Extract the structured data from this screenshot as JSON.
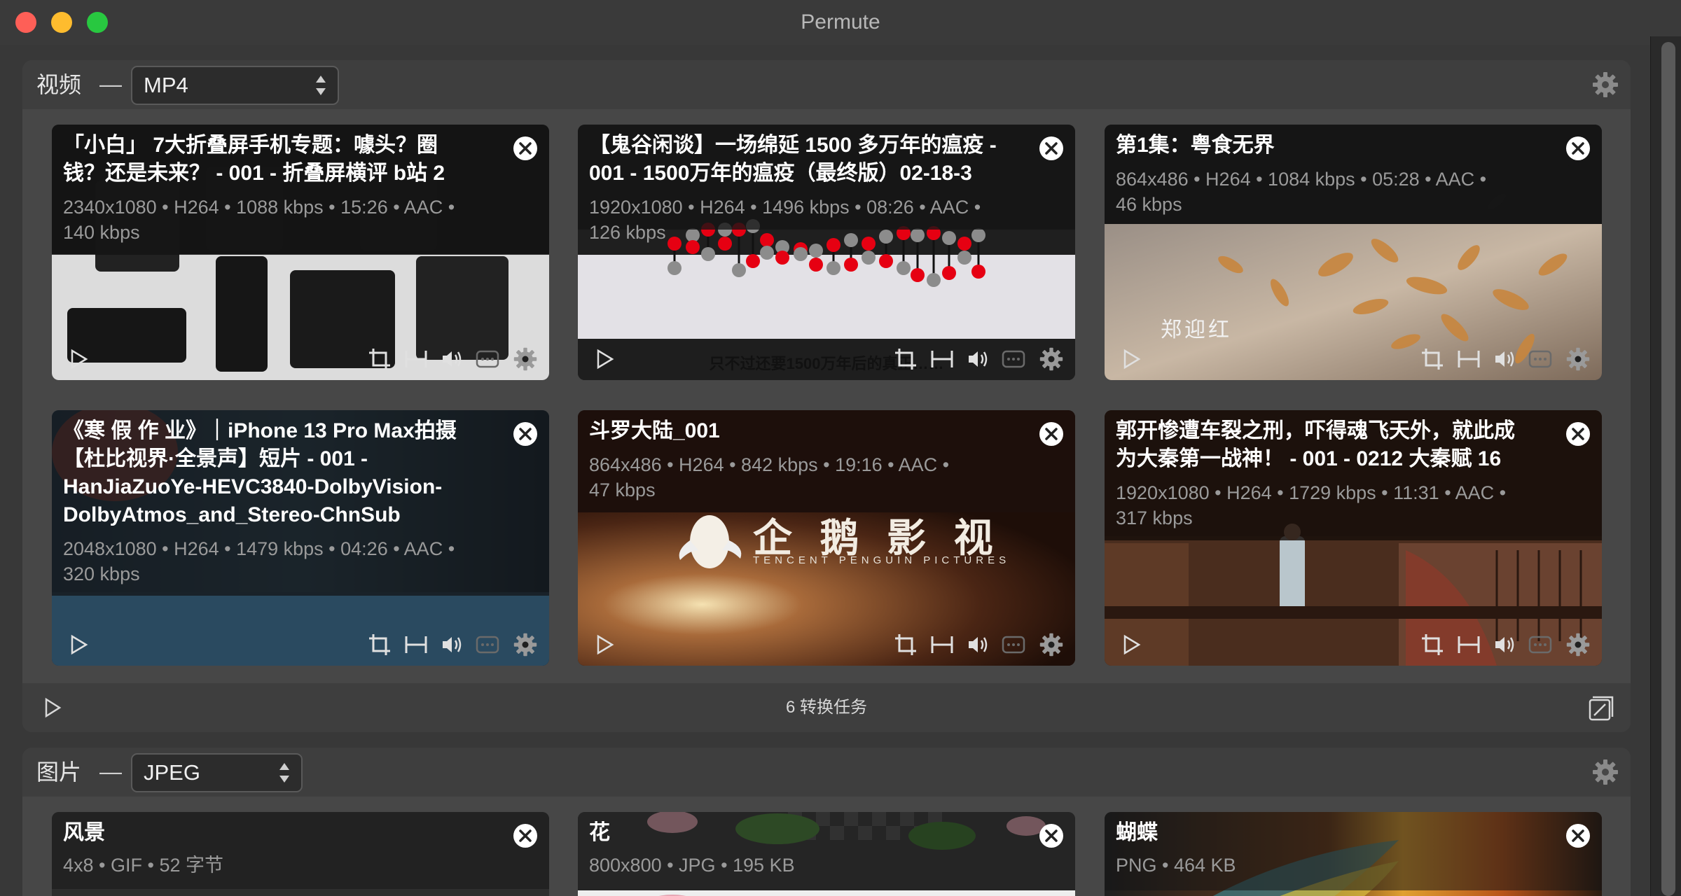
{
  "window": {
    "title": "Permute"
  },
  "sections": [
    {
      "label": "视频",
      "dash": "—",
      "format": "MP4",
      "status": "6 转换任务",
      "cards": [
        {
          "title": "「小白」 7大折叠屏手机专题：噱头？圈\n钱？还是未来？ - 001 - 折叠屏横评 b站 2",
          "meta": "2340x1080 • H264 • 1088 kbps • 15:26 • AAC •\n140 kbps"
        },
        {
          "title": "【鬼谷闲谈】一场绵延 1500 多万年的瘟疫 -\n001 - 1500万年的瘟疫（最终版）02-18-3",
          "meta": "1920x1080 • H264 • 1496 kbps • 08:26 • AAC •\n126 kbps",
          "caption": "只不过还要1500万年后的真正……"
        },
        {
          "title": "第1集：粤食无界",
          "meta": "864x486 • H264 • 1084 kbps • 05:28 • AAC •\n46 kbps",
          "caption": "郑迎红"
        },
        {
          "title": "《寒 假 作 业》｜iPhone 13 Pro Max拍摄\n【杜比视界·全景声】短片 - 001 -\nHanJiaZuoYe-HEVC3840-DolbyVision-\nDolbyAtmos_and_Stereo-ChnSub",
          "meta": "2048x1080 • H264 • 1479 kbps • 04:26 • AAC •\n320 kbps"
        },
        {
          "title": "斗罗大陆_001",
          "meta": "864x486 • H264 • 842 kbps • 19:16 • AAC •\n47 kbps",
          "logo_text": "企 鹅 影 视",
          "logo_sub": "TENCENT PENGUIN PICTURES"
        },
        {
          "title": "郭开惨遭车裂之刑，吓得魂飞天外，就此成\n为大秦第一战神！ - 001 - 0212 大秦赋 16",
          "meta": "1920x1080 • H264 • 1729 kbps • 11:31 • AAC •\n317 kbps"
        }
      ]
    },
    {
      "label": "图片",
      "dash": "—",
      "format": "JPEG",
      "cards": [
        {
          "title": "风景",
          "meta": "4x8 • GIF • 52 字节"
        },
        {
          "title": "花",
          "meta": "800x800 • JPG • 195 KB"
        },
        {
          "title": "蝴蝶",
          "meta": "PNG • 464 KB"
        }
      ]
    }
  ],
  "icons": {
    "close": "close-circle-icon",
    "play": "play-icon",
    "crop": "crop-icon",
    "trim": "trim-icon",
    "volume": "volume-icon",
    "subtitles": "subtitles-icon",
    "settings": "gear-icon",
    "batch": "batch-edit-icon",
    "format_arrows": "updown-arrows-icon"
  },
  "colors": {
    "window_bg": "#383838",
    "panel_bg": "#474747",
    "panel_header": "#3e3e3e",
    "title_bar": "#3a3a3a",
    "traffic_close": "#fe5f57",
    "traffic_minimize": "#febc2e",
    "traffic_maximize": "#28c840",
    "card_title": "#ffffff",
    "card_meta": "#9a9a9a",
    "chart_red": "#e60012"
  }
}
